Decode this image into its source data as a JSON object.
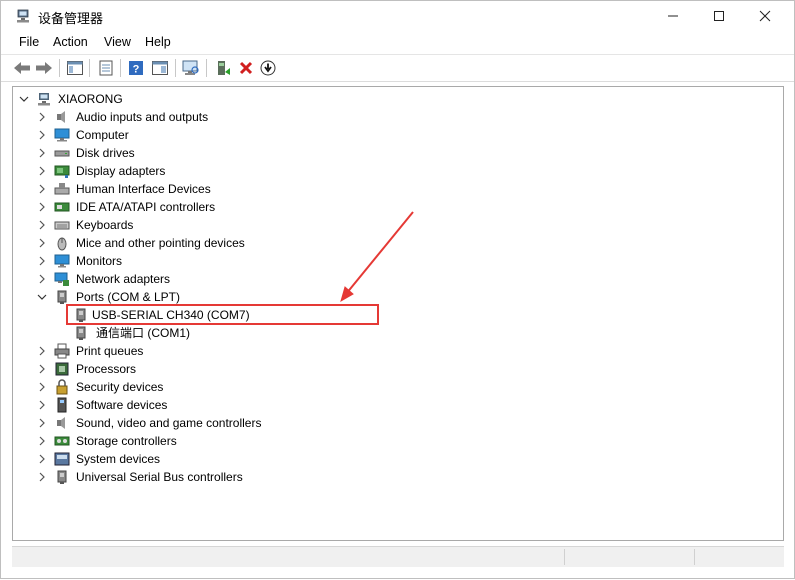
{
  "window": {
    "title": "设备管理器"
  },
  "menu": [
    "File",
    "Action",
    "View",
    "Help"
  ],
  "tree": {
    "root": "XIAORONG",
    "categories": [
      {
        "label": "Audio inputs and outputs",
        "icon": "speaker-icon"
      },
      {
        "label": "Computer",
        "icon": "computer-icon"
      },
      {
        "label": "Disk drives",
        "icon": "disk-drive-icon"
      },
      {
        "label": "Display adapters",
        "icon": "display-adapter-icon"
      },
      {
        "label": "Human Interface Devices",
        "icon": "hid-icon"
      },
      {
        "label": "IDE ATA/ATAPI controllers",
        "icon": "ide-controller-icon"
      },
      {
        "label": "Keyboards",
        "icon": "keyboard-icon"
      },
      {
        "label": "Mice and other pointing devices",
        "icon": "mouse-icon"
      },
      {
        "label": "Monitors",
        "icon": "monitor-icon"
      },
      {
        "label": "Network adapters",
        "icon": "network-adapter-icon"
      },
      {
        "label": "Ports (COM & LPT)",
        "icon": "port-icon"
      },
      {
        "label": "Print queues",
        "icon": "printer-icon"
      },
      {
        "label": "Processors",
        "icon": "processor-icon"
      },
      {
        "label": "Security devices",
        "icon": "security-device-icon"
      },
      {
        "label": "Software devices",
        "icon": "software-device-icon"
      },
      {
        "label": "Sound, video and game controllers",
        "icon": "sound-controller-icon"
      },
      {
        "label": "Storage controllers",
        "icon": "storage-controller-icon"
      },
      {
        "label": "System devices",
        "icon": "system-device-icon"
      },
      {
        "label": "Universal Serial Bus controllers",
        "icon": "usb-controller-icon"
      }
    ],
    "ports_children": [
      "USB-SERIAL CH340 (COM7)",
      "通信端口 (COM1)"
    ]
  },
  "colors": {
    "highlight": "#e53935",
    "arrow": "#e53935"
  }
}
